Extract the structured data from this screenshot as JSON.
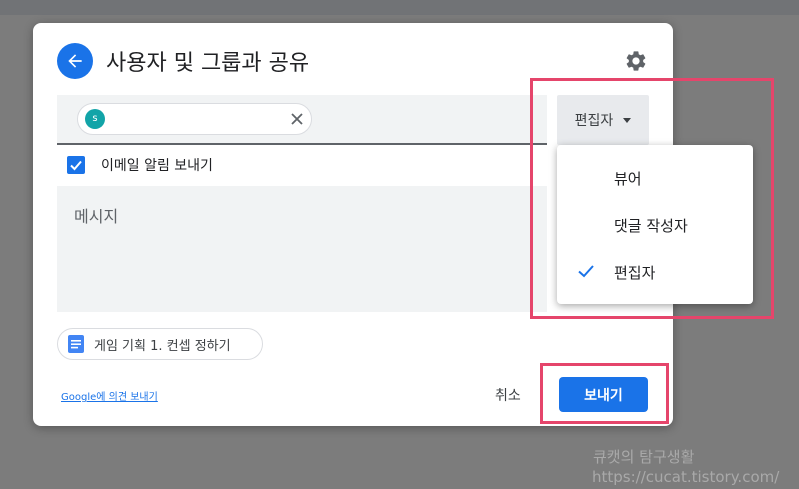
{
  "dialog": {
    "title": "사용자 및 그룹과 공유",
    "chip": {
      "avatar_letter": "s",
      "avatar_color": "#12a4a8"
    },
    "role_button_label": "편집자",
    "notify_label": "이메일 알림 보내기",
    "notify_checked": true,
    "message_placeholder": "메시지",
    "doc_chip_label": "게임 기획 1. 컨셉 정하기",
    "feedback_link": "Google에 의견 보내기",
    "cancel_label": "취소",
    "send_label": "보내기"
  },
  "role_menu": {
    "items": [
      {
        "label": "뷰어",
        "selected": false
      },
      {
        "label": "댓글 작성자",
        "selected": false
      },
      {
        "label": "편집자",
        "selected": true
      }
    ]
  },
  "watermark": {
    "line1": "큐캣의 탐구생활",
    "line2": "https://cucat.tistory.com/"
  },
  "colors": {
    "accent": "#1a73e8",
    "highlight": "#e5456b",
    "backdrop": "#7c7c7c"
  },
  "icons": {
    "back": "arrow-left-icon",
    "settings": "gear-icon",
    "chip_remove": "close-icon",
    "role_dropdown": "caret-down-icon",
    "notify": "checkbox-checked-icon",
    "doc": "google-docs-icon",
    "selected_role": "check-icon"
  }
}
